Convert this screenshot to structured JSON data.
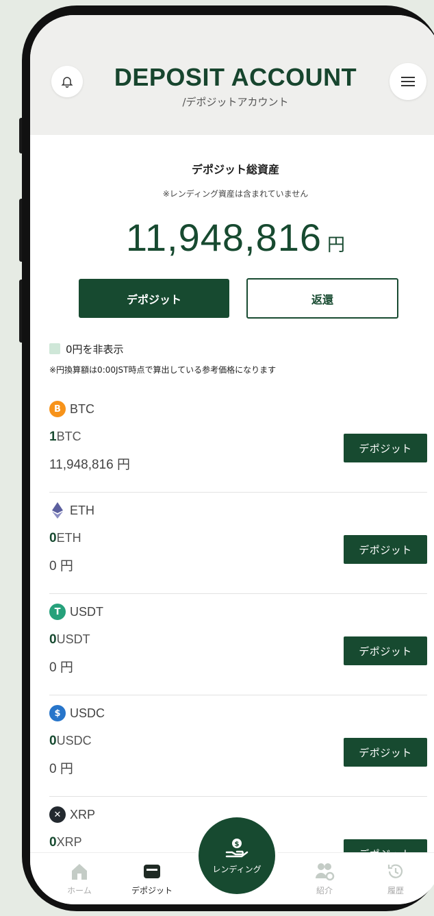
{
  "header": {
    "title": "DEPOSIT ACCOUNT",
    "subtitle": "/デポジットアカウント",
    "bell_icon": "bell-icon",
    "menu_icon": "hamburger-menu-icon"
  },
  "summary": {
    "label": "デポジット総資産",
    "note": "※レンディング資産は含まれていません",
    "amount": "11,948,816",
    "unit": "円"
  },
  "actions": {
    "deposit_label": "デポジット",
    "repay_label": "返還"
  },
  "filter": {
    "hide_zero_label": "0円を非表示",
    "rate_note": "※円換算額は0:00JST時点で算出している参考価格になります"
  },
  "assets": [
    {
      "symbol": "BTC",
      "qty": "1",
      "unit": "BTC",
      "yen": "11,948,816 円",
      "button": "デポジット",
      "icon": "bitcoin-icon",
      "color": "#f7931a",
      "glyph": "B"
    },
    {
      "symbol": "ETH",
      "qty": "0",
      "unit": "ETH",
      "yen": "0 円",
      "button": "デポジット",
      "icon": "ethereum-icon",
      "color": "#5b5f9e",
      "glyph": ""
    },
    {
      "symbol": "USDT",
      "qty": "0",
      "unit": "USDT",
      "yen": "0 円",
      "button": "デポジット",
      "icon": "tether-icon",
      "color": "#26a17b",
      "glyph": "T"
    },
    {
      "symbol": "USDC",
      "qty": "0",
      "unit": "USDC",
      "yen": "0 円",
      "button": "デポジット",
      "icon": "usdc-icon",
      "color": "#2775ca",
      "glyph": "$"
    },
    {
      "symbol": "XRP",
      "qty": "0",
      "unit": "XRP",
      "yen": "",
      "button": "デポジット",
      "icon": "xrp-icon",
      "color": "#23292f",
      "glyph": "✕"
    }
  ],
  "nav": {
    "home": "ホーム",
    "deposit": "デポジット",
    "lending": "レンディング",
    "referral": "紹介",
    "history": "履歴"
  }
}
